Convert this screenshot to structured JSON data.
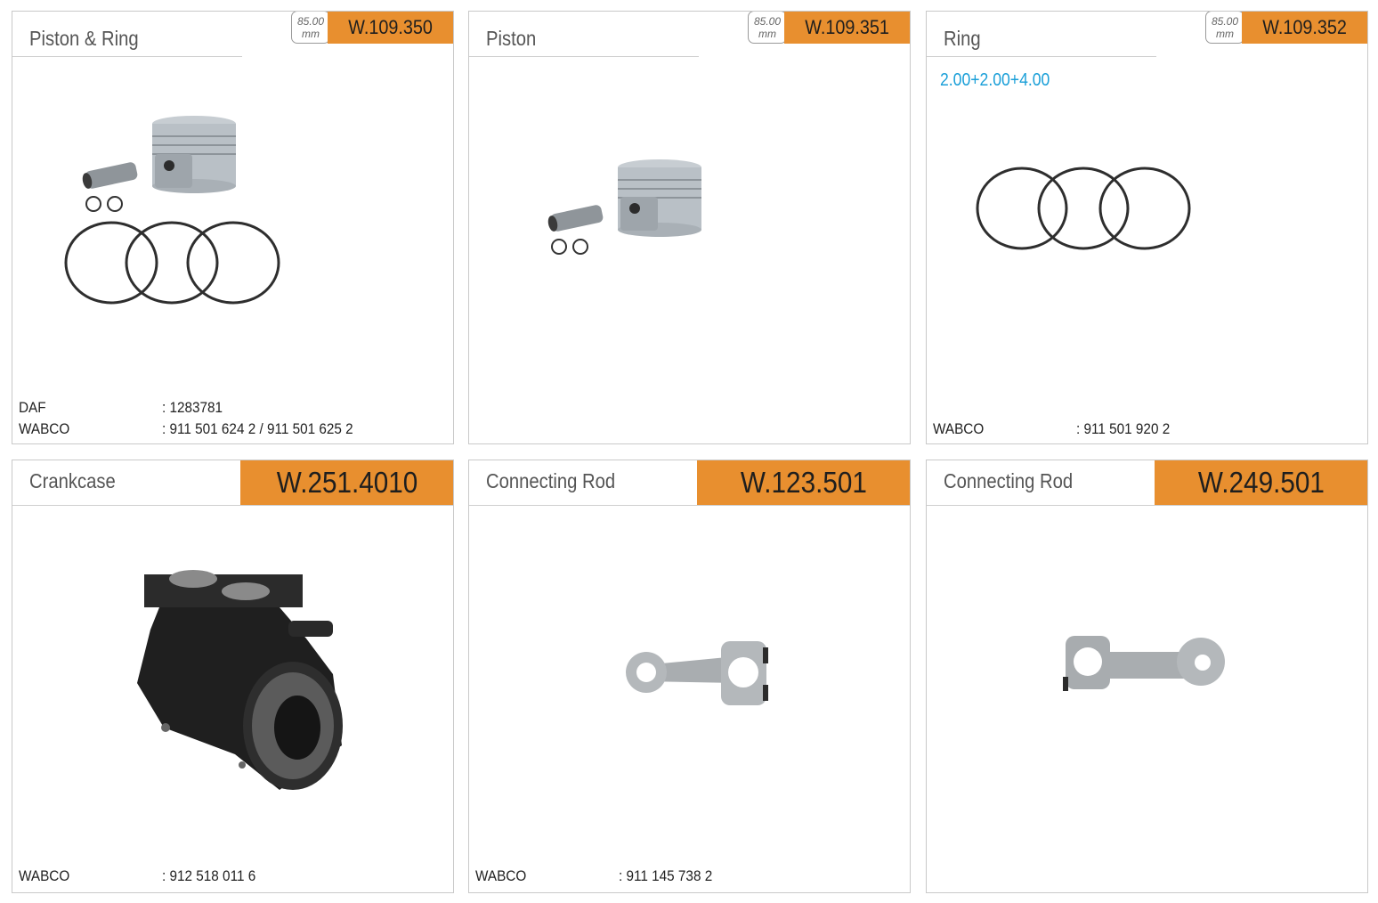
{
  "cards": [
    {
      "title": "Piston & Ring",
      "code": "W.109.350",
      "size": {
        "value": "85.00",
        "unit": "mm"
      },
      "image": "piston-and-ring-set-image",
      "references": [
        {
          "brand": "DAF",
          "number": ": 1283781"
        },
        {
          "brand": "WABCO",
          "number": ": 911 501 624 2 / 911 501 625 2"
        }
      ]
    },
    {
      "title": "Piston",
      "code": "W.109.351",
      "size": {
        "value": "85.00",
        "unit": "mm"
      },
      "image": "piston-image",
      "references": []
    },
    {
      "title": "Ring",
      "code": "W.109.352",
      "size": {
        "value": "85.00",
        "unit": "mm"
      },
      "spec": "2.00+2.00+4.00",
      "image": "piston-rings-image",
      "references": [
        {
          "brand": "WABCO",
          "number": ": 911 501 920 2"
        }
      ]
    },
    {
      "title": "Crankcase",
      "code": "W.251.4010",
      "image": "crankcase-image",
      "references": [
        {
          "brand": "WABCO",
          "number": ": 912 518 011 6"
        }
      ]
    },
    {
      "title": "Connecting Rod",
      "code": "W.123.501",
      "image": "connecting-rod-image",
      "references": [
        {
          "brand": "WABCO",
          "number": ": 911 145 738 2"
        }
      ]
    },
    {
      "title": "Connecting Rod",
      "code": "W.249.501",
      "image": "connecting-rod-image",
      "references": []
    }
  ],
  "colors": {
    "code_badge": "#e88f2f",
    "spec_text": "#1a9fd8",
    "title_text": "#555555",
    "border": "#c9c9c9"
  }
}
